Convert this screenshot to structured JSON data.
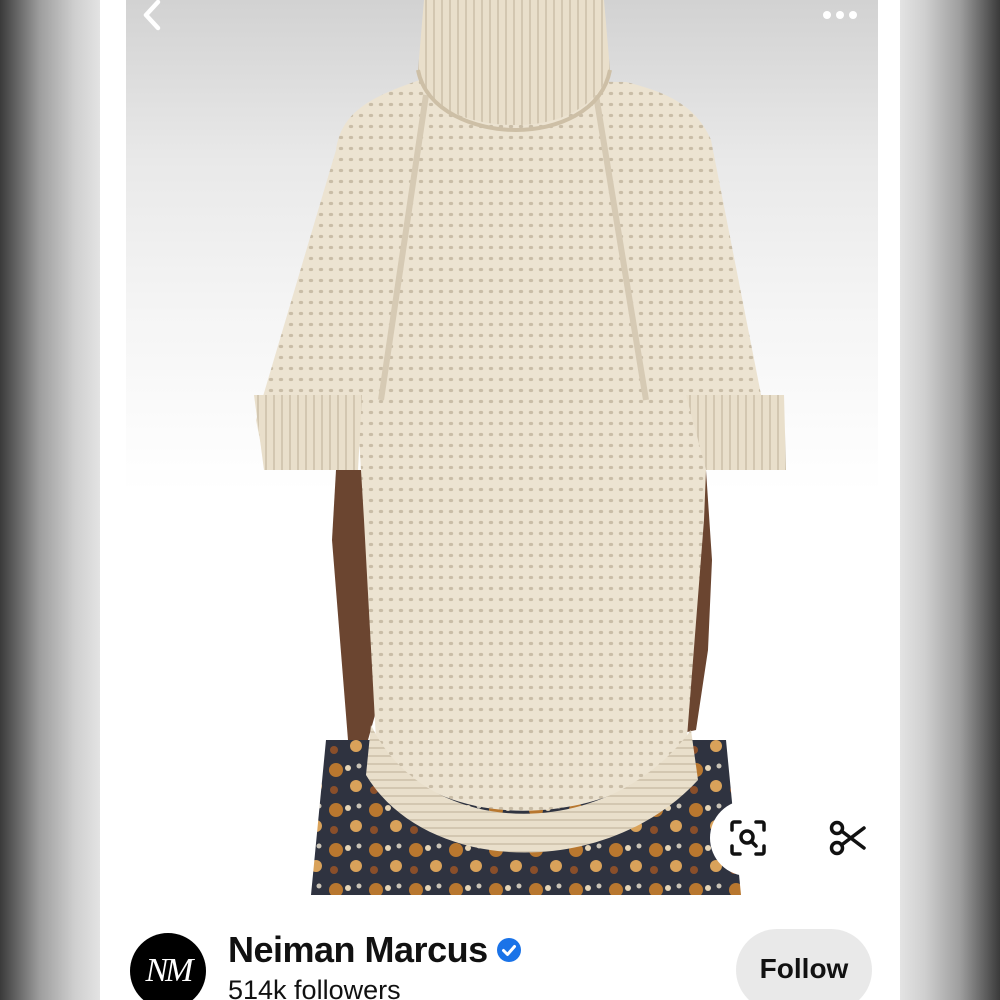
{
  "pin": {
    "image_alt": "Cream chunky-knit turtleneck poncho sweater worn over a floral skirt"
  },
  "nav": {
    "back_icon": "chevron-left-icon",
    "more_icon": "ellipsis-icon"
  },
  "overlay_actions": [
    {
      "icon": "visual-search-icon"
    },
    {
      "icon": "scissors-icon"
    }
  ],
  "creator": {
    "name": "Neiman Marcus",
    "avatar_text": "NM",
    "verified": true,
    "followers": "514k followers",
    "follow_label": "Follow"
  },
  "colors": {
    "verified_blue": "#1a73e8",
    "follow_button_bg": "#e9e9e9",
    "sweater": "#ece2d0"
  }
}
